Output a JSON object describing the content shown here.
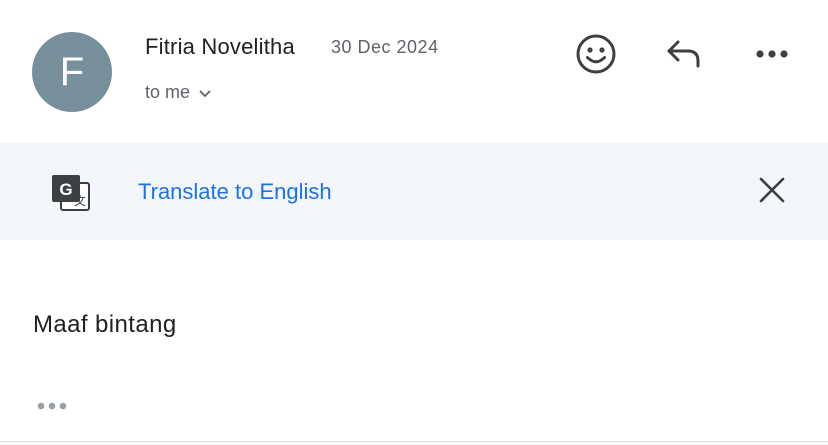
{
  "message": {
    "sender": {
      "initial": "F",
      "name": "Fitria Novelitha",
      "avatar_color": "#78909c"
    },
    "date": "30 Dec 2024",
    "recipient": "to me",
    "body": "Maaf bintang"
  },
  "actions": {
    "emoji_icon": "smiley-face-icon",
    "reply_icon": "reply-arrow-icon",
    "more_icon": "more-horizontal-icon"
  },
  "translate_bar": {
    "icon": "google-translate-icon",
    "link_label": "Translate to English",
    "close_icon": "close-x-icon"
  },
  "colors": {
    "link": "#1a73e8",
    "translate_bar_bg": "#f3f7fb",
    "secondary_text": "#5f6368"
  }
}
